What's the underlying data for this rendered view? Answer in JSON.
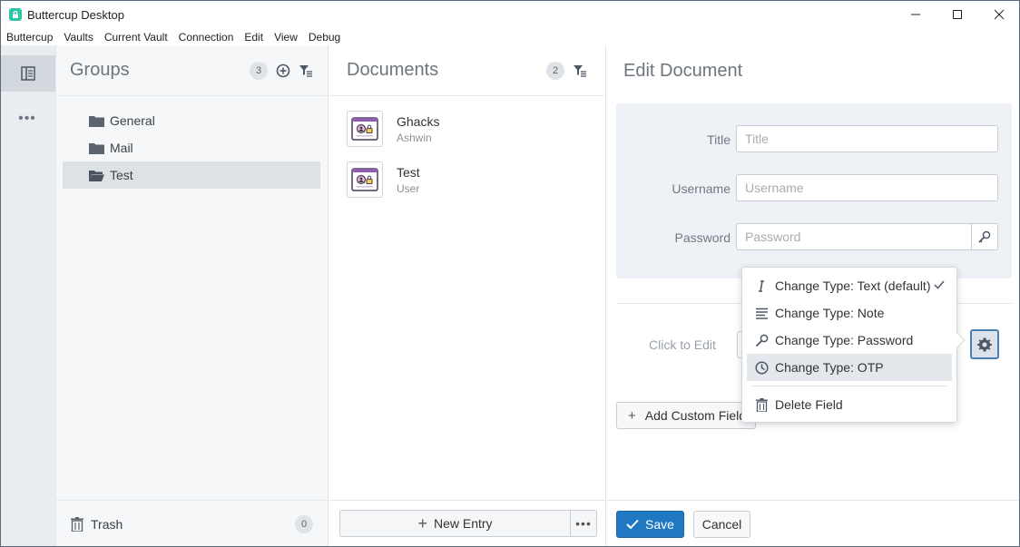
{
  "window": {
    "title": "Buttercup Desktop"
  },
  "menu": [
    "Buttercup",
    "Vaults",
    "Current Vault",
    "Connection",
    "Edit",
    "View",
    "Debug"
  ],
  "rail": {
    "more": "•••"
  },
  "groups": {
    "title": "Groups",
    "count": "3",
    "items": [
      {
        "label": "General"
      },
      {
        "label": "Mail"
      },
      {
        "label": "Test",
        "active": true
      }
    ],
    "trash": {
      "label": "Trash",
      "count": "0"
    }
  },
  "documents": {
    "title": "Documents",
    "count": "2",
    "items": [
      {
        "title": "Ghacks",
        "subtitle": "Ashwin"
      },
      {
        "title": "Test",
        "subtitle": "User"
      }
    ],
    "new_entry": "New Entry",
    "more": "•••"
  },
  "edit": {
    "title": "Edit Document",
    "fields": {
      "title": {
        "label": "Title",
        "placeholder": "Title"
      },
      "username": {
        "label": "Username",
        "placeholder": "Username"
      },
      "password": {
        "label": "Password",
        "placeholder": "Password"
      }
    },
    "click_to_edit": "Click to Edit",
    "add_custom_field": "Add Custom Field",
    "save": "Save",
    "cancel": "Cancel"
  },
  "context_menu": {
    "items": [
      {
        "label": "Change Type: Text (default)",
        "icon": "text-cursor-icon",
        "checked": true
      },
      {
        "label": "Change Type: Note",
        "icon": "note-lines-icon"
      },
      {
        "label": "Change Type: Password",
        "icon": "key-icon"
      },
      {
        "label": "Change Type: OTP",
        "icon": "clock-icon",
        "highlighted": true
      }
    ],
    "delete": {
      "label": "Delete Field",
      "icon": "trash-icon"
    }
  },
  "colors": {
    "accent": "#1f78c1",
    "brand": "#2ec4a7",
    "sidebar": "#eaedf0"
  }
}
